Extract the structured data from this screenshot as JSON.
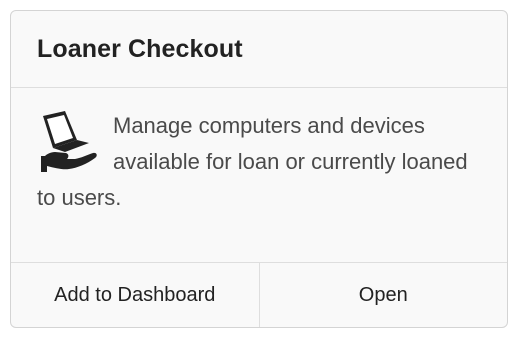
{
  "card": {
    "title": "Loaner Checkout",
    "description": "Manage computers and devices available for loan or currently loaned to users.",
    "icon": "laptop-in-hand-icon"
  },
  "footer": {
    "add_label": "Add to Dashboard",
    "open_label": "Open"
  },
  "colors": {
    "border": "#d4d4d4",
    "card_background": "#f9f9f9",
    "text": "#222222",
    "description_text": "#4a4a4a"
  }
}
